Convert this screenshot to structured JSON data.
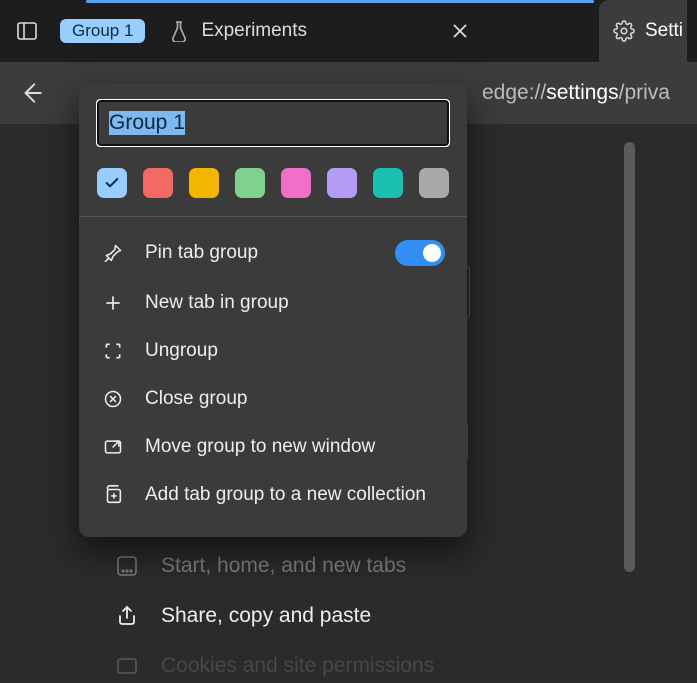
{
  "tabstrip": {
    "group_chip": "Group 1",
    "tab_label": "Experiments",
    "settings_label": "Setti"
  },
  "addressbar": {
    "prefix": "edge://",
    "bold": "settings",
    "suffix": "/priva"
  },
  "popup": {
    "name_value": "Group 1",
    "colors": [
      {
        "hex": "#98ceff",
        "selected": true
      },
      {
        "hex": "#f26a63",
        "selected": false
      },
      {
        "hex": "#f3b600",
        "selected": false
      },
      {
        "hex": "#7fd28e",
        "selected": false
      },
      {
        "hex": "#f26fc9",
        "selected": false
      },
      {
        "hex": "#b39cf6",
        "selected": false
      },
      {
        "hex": "#19c0b2",
        "selected": false
      },
      {
        "hex": "#a9a9a9",
        "selected": false
      }
    ],
    "items": {
      "pin": "Pin tab group",
      "newtab": "New tab in group",
      "ungroup": "Ungroup",
      "close": "Close group",
      "move": "Move group to new window",
      "collection": "Add tab group to a new collection"
    },
    "pin_toggle_on": true
  },
  "settings_page": {
    "item_start": "Start, home, and new tabs",
    "item_share": "Share, copy and paste",
    "item_cookies": "Cookies and site permissions",
    "item_faded_suffix": "s"
  }
}
